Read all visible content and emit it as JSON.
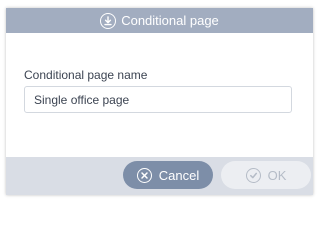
{
  "dialog": {
    "title": "Conditional page",
    "title_icon": "download-icon"
  },
  "form": {
    "label": "Conditional page name",
    "value": "Single office page"
  },
  "buttons": {
    "cancel_label": "Cancel",
    "cancel_icon": "cancel-x-icon",
    "ok_label": "OK",
    "ok_icon": "check-icon",
    "ok_enabled": false
  },
  "colors": {
    "titlebar": "#a2adc0",
    "footer": "#d9dde5",
    "cancel_button": "#7d8ea8",
    "ok_button_disabled": "#eceef2"
  }
}
